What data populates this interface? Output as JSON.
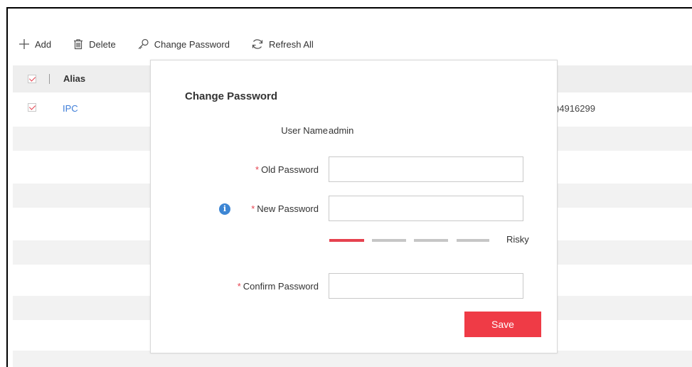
{
  "toolbar": {
    "add_label": "Add",
    "delete_label": "Delete",
    "change_password_label": "Change Password",
    "refresh_all_label": "Refresh All"
  },
  "table": {
    "columns": [
      "Alias"
    ],
    "rows": [
      {
        "alias": "IPC",
        "serial_fragment": ")4916299",
        "checked": true
      }
    ],
    "header_checked": true
  },
  "dialog": {
    "title": "Change Password",
    "user_name_label": "User Name",
    "user_name_value": "admin",
    "required_marker": "*",
    "old_password_label": "Old Password",
    "old_password_value": "",
    "new_password_label": "New Password",
    "new_password_value": "",
    "info_icon": "i",
    "strength": {
      "level": 1,
      "max": 4,
      "label": "Risky"
    },
    "confirm_password_label": "Confirm Password",
    "confirm_password_value": "",
    "save_label": "Save"
  },
  "colors": {
    "accent": "#ef3b46",
    "link": "#3d7dd8",
    "info": "#3d86d4",
    "strength_off": "#c6c6c6"
  }
}
